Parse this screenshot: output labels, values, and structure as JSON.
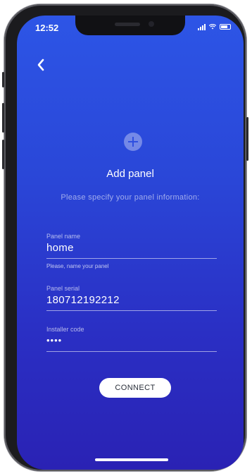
{
  "status_bar": {
    "time": "12:52"
  },
  "nav": {
    "back_icon": "chevron-left-icon"
  },
  "header": {
    "add_icon": "plus-circle-icon",
    "title": "Add panel",
    "subtitle": "Please specify your panel information:"
  },
  "form": {
    "panel_name": {
      "label": "Panel name",
      "value": "home",
      "hint": "Please, name your panel"
    },
    "panel_serial": {
      "label": "Panel serial",
      "value": "180712192212"
    },
    "installer_code": {
      "label": "Installer code",
      "value": "••••"
    }
  },
  "actions": {
    "connect_label": "CONNECT"
  },
  "colors": {
    "background_top": "#2d55e6",
    "background_bottom": "#2a22b4",
    "text": "#ffffff",
    "button_bg": "#ffffff"
  }
}
